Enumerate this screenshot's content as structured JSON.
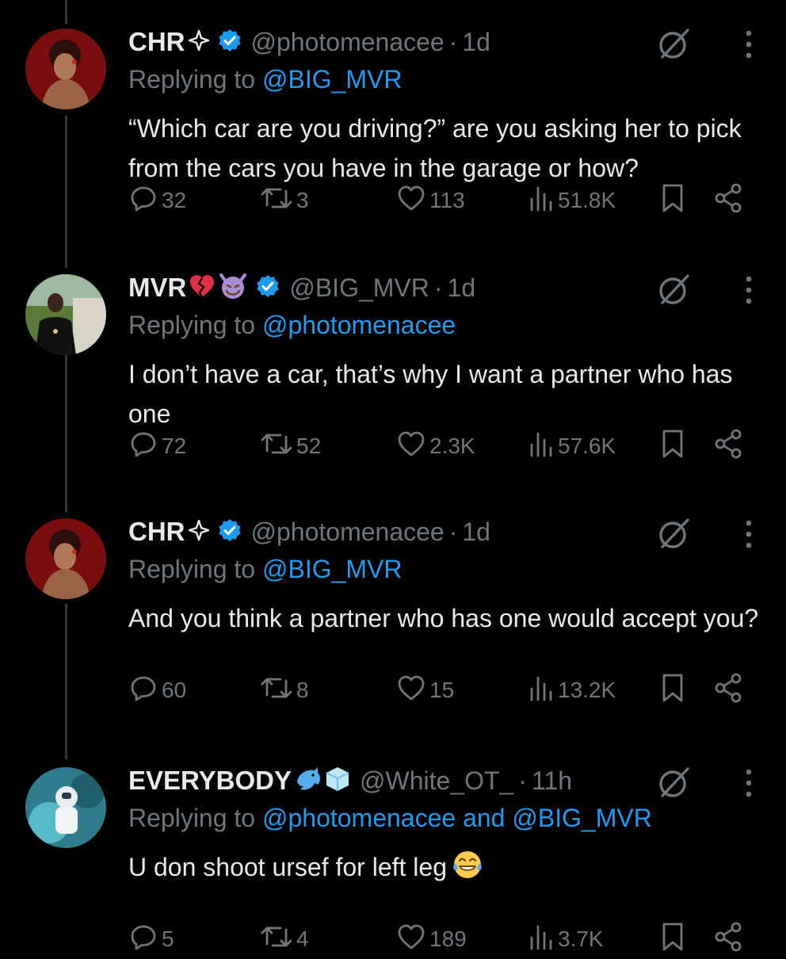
{
  "tweets": [
    {
      "name": "CHR",
      "name_emojis": [
        "sparkle-outline-icon"
      ],
      "handle": "@photomenacee",
      "time": "1d",
      "replying_prefix": "Replying to ",
      "replying_to": "@BIG_MVR",
      "replying_to_2": "",
      "body": "“Which car are you driving?” are you asking her to pick from the cars you have in the garage or how?",
      "replies": "32",
      "retweets": "3",
      "likes": "113",
      "views": "51.8K"
    },
    {
      "name": "MVR",
      "name_emojis": [
        "broken-heart-icon",
        "smiling-devil-icon"
      ],
      "handle": "@BIG_MVR",
      "time": "1d",
      "replying_prefix": "Replying to ",
      "replying_to": "@photomenacee",
      "replying_to_2": "",
      "body": "I don’t have a car, that’s why I want a partner who has one",
      "replies": "72",
      "retweets": "52",
      "likes": "2.3K",
      "views": "57.6K"
    },
    {
      "name": "CHR",
      "name_emojis": [
        "sparkle-outline-icon"
      ],
      "handle": "@photomenacee",
      "time": "1d",
      "replying_prefix": "Replying to ",
      "replying_to": "@BIG_MVR",
      "replying_to_2": "",
      "body": "And you think a partner who has one would accept you?",
      "replies": "60",
      "retweets": "8",
      "likes": "15",
      "views": "13.2K"
    },
    {
      "name": "EVERYBODY",
      "name_emojis": [
        "dolphin-icon",
        "ice-cube-icon"
      ],
      "handle": "@White_OT_",
      "time": "11h",
      "replying_prefix": "Replying to ",
      "replying_to": "@photomenacee",
      "replying_and": " and ",
      "replying_to_2": "@BIG_MVR",
      "body": "U don shoot ursef for left leg",
      "body_emoji": "tears-of-joy-icon",
      "replies": "5",
      "retweets": "4",
      "likes": "189",
      "views": "3.7K"
    }
  ],
  "colors": {
    "background": "#000000",
    "text": "#e7e9ea",
    "muted": "#71767b",
    "accent": "#1d9bf0",
    "thread_line": "#333639"
  }
}
